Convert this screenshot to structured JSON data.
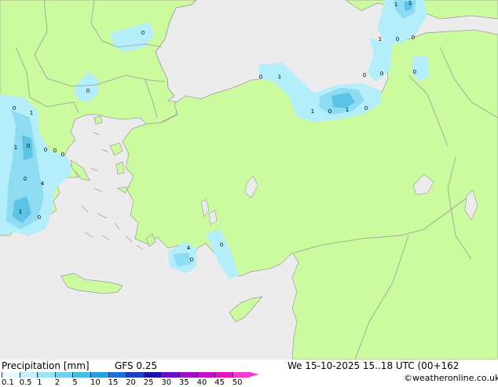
{
  "map": {
    "colors": {
      "sea": "#ececec",
      "land": "#ccfa9e",
      "coast": "#9a9a9a",
      "border": "#9a9a9a",
      "precip_light": "#b3eefa",
      "precip_mid": "#8edcf2",
      "precip_high": "#5cc2e6"
    },
    "point_labels": [
      "0",
      "1",
      "1",
      "1",
      "0",
      "0",
      "0",
      "0",
      "0",
      "0",
      "1",
      "1",
      "0",
      "1",
      "0",
      "0",
      "0",
      "1",
      "0",
      "0",
      "0",
      "0",
      "4",
      "1",
      "0",
      "0",
      "0",
      "4",
      "1",
      "0"
    ]
  },
  "footer": {
    "title": "Precipitation [mm]",
    "model": "GFS 0.25",
    "datetime": "We 15-10-2025 15..18 UTC (00+162",
    "credit": "©weatheronline.co.uk",
    "scale": [
      {
        "label": "0.1",
        "color": "#e6f9fd"
      },
      {
        "label": "0.5",
        "color": "#c2f0fa"
      },
      {
        "label": "1",
        "color": "#9ae4f5"
      },
      {
        "label": "2",
        "color": "#6fd2ee"
      },
      {
        "label": "5",
        "color": "#45bde6"
      },
      {
        "label": "10",
        "color": "#2a9ee0"
      },
      {
        "label": "15",
        "color": "#1f6fd6"
      },
      {
        "label": "20",
        "color": "#1c3fc8"
      },
      {
        "label": "25",
        "color": "#1a12b0"
      },
      {
        "label": "30",
        "color": "#6a0fc9"
      },
      {
        "label": "35",
        "color": "#9e10cc"
      },
      {
        "label": "40",
        "color": "#c512c8"
      },
      {
        "label": "45",
        "color": "#e018c0"
      },
      {
        "label": "50",
        "color": "#f03cd0"
      }
    ]
  }
}
